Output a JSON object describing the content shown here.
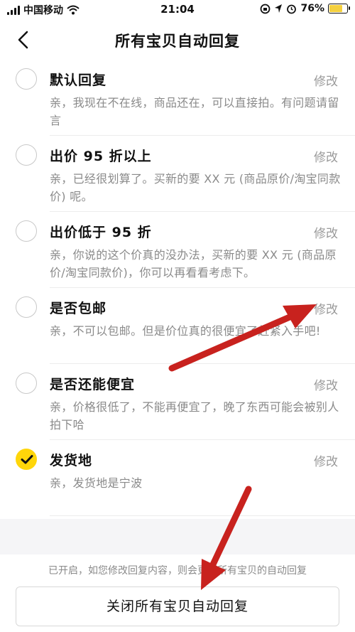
{
  "status_bar": {
    "carrier": "中国移动",
    "time": "21:04",
    "battery": "76%",
    "battery_level": 0.76
  },
  "header": {
    "title": "所有宝贝自动回复",
    "back_icon": "chevron-left-icon"
  },
  "replies": [
    {
      "title": "默认回复",
      "desc": "亲，我现在不在线，商品还在，可以直接拍。有问题请留言",
      "edit": "修改",
      "checked": false
    },
    {
      "title": "出价 95 折以上",
      "desc": "亲，已经很划算了。买新的要 XX 元 (商品原价/淘宝同款价) 呢。",
      "edit": "修改",
      "checked": false
    },
    {
      "title": "出价低于 95 折",
      "desc": "亲，你说的这个价真的没办法，买新的要 XX 元 (商品原价/淘宝同款价)，你可以再看看考虑下。",
      "edit": "修改",
      "checked": false
    },
    {
      "title": "是否包邮",
      "desc": "亲，不可以包邮。但是价位真的很便宜了赶紧入手吧!",
      "edit": "修改",
      "checked": false
    },
    {
      "title": "是否还能便宜",
      "desc": "亲，价格很低了，不能再便宜了，晚了东西可能会被别人拍下哈",
      "edit": "修改",
      "checked": false
    },
    {
      "title": "发货地",
      "desc": "亲，发货地是宁波",
      "edit": "修改",
      "checked": true
    }
  ],
  "footer": {
    "note": "已开启，如您修改回复内容，则会更新所有宝贝的自动回复",
    "close_button": "关闭所有宝贝自动回复"
  },
  "colors": {
    "accent": "#ffd60a",
    "annotation_arrow": "#c8221e"
  }
}
